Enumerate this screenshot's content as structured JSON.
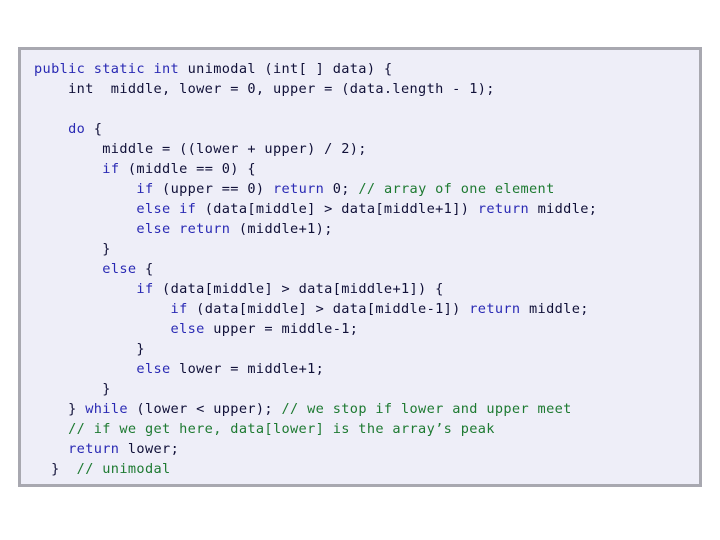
{
  "slide": {
    "background_color": "#ffffff",
    "panel": {
      "background_color": "#eeeef8",
      "border_color": "#a8a8b0"
    }
  },
  "syntax_colors": {
    "keyword": "#2a2ab4",
    "identifier": "#101038",
    "comment": "#1e7a32"
  },
  "code": {
    "language": "java",
    "method_name": "unimodal",
    "plain_text": "public static int unimodal (int[ ] data) {\n    int  middle, lower = 0, upper = (data.length - 1);\n\n    do {\n        middle = ((lower + upper) / 2);\n        if (middle == 0) {\n            if (upper == 0) return 0; // array of one element\n            else if (data[middle] > data[middle+1]) return middle;\n            else return (middle+1);\n        }\n        else {\n            if (data[middle] > data[middle+1]) {\n                if (data[middle] > data[middle-1]) return middle;\n                else upper = middle-1;\n            }\n            else lower = middle+1;\n        }\n    } while (lower < upper); // we stop if lower and upper meet\n    // if we get here, data[lower] is the array’s peak\n    return lower;\n}  // unimodal",
    "lines": [
      {
        "id": "line-1",
        "tokens": [
          {
            "t": "public static int ",
            "c": "kw"
          },
          {
            "t": "unimodal (int[ ] data) {",
            "c": "id"
          }
        ]
      },
      {
        "id": "line-2",
        "tokens": [
          {
            "t": "    int  middle, lower = 0, upper = (data.length - 1);",
            "c": "id"
          }
        ]
      },
      {
        "id": "line-3",
        "tokens": [
          {
            "t": "",
            "c": "id"
          }
        ]
      },
      {
        "id": "line-4",
        "tokens": [
          {
            "t": "    ",
            "c": "id"
          },
          {
            "t": "do",
            "c": "kw"
          },
          {
            "t": " {",
            "c": "id"
          }
        ]
      },
      {
        "id": "line-5",
        "tokens": [
          {
            "t": "        middle = ((lower + upper) / 2);",
            "c": "id"
          }
        ]
      },
      {
        "id": "line-6",
        "tokens": [
          {
            "t": "        ",
            "c": "id"
          },
          {
            "t": "if",
            "c": "kw"
          },
          {
            "t": " (middle == 0) {",
            "c": "id"
          }
        ]
      },
      {
        "id": "line-7",
        "tokens": [
          {
            "t": "            ",
            "c": "id"
          },
          {
            "t": "if",
            "c": "kw"
          },
          {
            "t": " (upper == 0) ",
            "c": "id"
          },
          {
            "t": "return",
            "c": "kw"
          },
          {
            "t": " 0; ",
            "c": "id"
          },
          {
            "t": "// array of one element",
            "c": "cmt"
          }
        ]
      },
      {
        "id": "line-8",
        "tokens": [
          {
            "t": "            ",
            "c": "id"
          },
          {
            "t": "else if",
            "c": "kw"
          },
          {
            "t": " (data[middle] > data[middle+1]) ",
            "c": "id"
          },
          {
            "t": "return",
            "c": "kw"
          },
          {
            "t": " middle;",
            "c": "id"
          }
        ]
      },
      {
        "id": "line-9",
        "tokens": [
          {
            "t": "            ",
            "c": "id"
          },
          {
            "t": "else return",
            "c": "kw"
          },
          {
            "t": " (middle+1);",
            "c": "id"
          }
        ]
      },
      {
        "id": "line-10",
        "tokens": [
          {
            "t": "        }",
            "c": "id"
          }
        ]
      },
      {
        "id": "line-11",
        "tokens": [
          {
            "t": "        ",
            "c": "id"
          },
          {
            "t": "else",
            "c": "kw"
          },
          {
            "t": " {",
            "c": "id"
          }
        ]
      },
      {
        "id": "line-12",
        "tokens": [
          {
            "t": "            ",
            "c": "id"
          },
          {
            "t": "if",
            "c": "kw"
          },
          {
            "t": " (data[middle] > data[middle+1]) {",
            "c": "id"
          }
        ]
      },
      {
        "id": "line-13",
        "tokens": [
          {
            "t": "                ",
            "c": "id"
          },
          {
            "t": "if",
            "c": "kw"
          },
          {
            "t": " (data[middle] > data[middle-1]) ",
            "c": "id"
          },
          {
            "t": "return",
            "c": "kw"
          },
          {
            "t": " middle;",
            "c": "id"
          }
        ]
      },
      {
        "id": "line-14",
        "tokens": [
          {
            "t": "                ",
            "c": "id"
          },
          {
            "t": "else",
            "c": "kw"
          },
          {
            "t": " upper = middle-1;",
            "c": "id"
          }
        ]
      },
      {
        "id": "line-15",
        "tokens": [
          {
            "t": "            }",
            "c": "id"
          }
        ]
      },
      {
        "id": "line-16",
        "tokens": [
          {
            "t": "            ",
            "c": "id"
          },
          {
            "t": "else",
            "c": "kw"
          },
          {
            "t": " lower = middle+1;",
            "c": "id"
          }
        ]
      },
      {
        "id": "line-17",
        "tokens": [
          {
            "t": "        }",
            "c": "id"
          }
        ]
      },
      {
        "id": "line-18",
        "tokens": [
          {
            "t": "    } ",
            "c": "id"
          },
          {
            "t": "while",
            "c": "kw"
          },
          {
            "t": " (lower < upper); ",
            "c": "id"
          },
          {
            "t": "// we stop if lower and upper meet",
            "c": "cmt"
          }
        ]
      },
      {
        "id": "line-19",
        "tokens": [
          {
            "t": "    ",
            "c": "id"
          },
          {
            "t": "// if we get here, data[lower] is the array’s peak",
            "c": "cmt"
          }
        ]
      },
      {
        "id": "line-20",
        "tokens": [
          {
            "t": "    ",
            "c": "id"
          },
          {
            "t": "return",
            "c": "kw"
          },
          {
            "t": " lower;",
            "c": "id"
          }
        ]
      },
      {
        "id": "line-21",
        "tokens": [
          {
            "t": "  }  ",
            "c": "id"
          },
          {
            "t": "// unimodal",
            "c": "cmt"
          }
        ]
      }
    ]
  }
}
